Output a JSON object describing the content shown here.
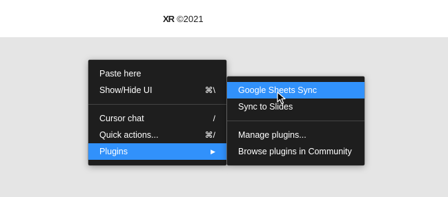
{
  "header": {
    "logo_text": "XR",
    "copyright": "©2021"
  },
  "context_menu": {
    "items_group1": [
      {
        "label": "Paste here",
        "shortcut": ""
      },
      {
        "label": "Show/Hide UI",
        "shortcut": "⌘\\"
      }
    ],
    "items_group2": [
      {
        "label": "Cursor chat",
        "shortcut": "/"
      },
      {
        "label": "Quick actions...",
        "shortcut": "⌘/"
      },
      {
        "label": "Plugins",
        "submenu_indicator": "▶"
      }
    ]
  },
  "plugins_submenu": {
    "items_group1": [
      {
        "label": "Google Sheets Sync"
      },
      {
        "label": "Sync to Slides"
      }
    ],
    "items_group2": [
      {
        "label": "Manage plugins..."
      },
      {
        "label": "Browse plugins in Community"
      }
    ]
  },
  "colors": {
    "menu_bg": "#1e1e1e",
    "highlight": "#3191fb",
    "canvas_bg": "#e5e5e5"
  },
  "icons": {
    "cursor": "pointer-arrow-icon",
    "submenu": "chevron-right-icon"
  }
}
